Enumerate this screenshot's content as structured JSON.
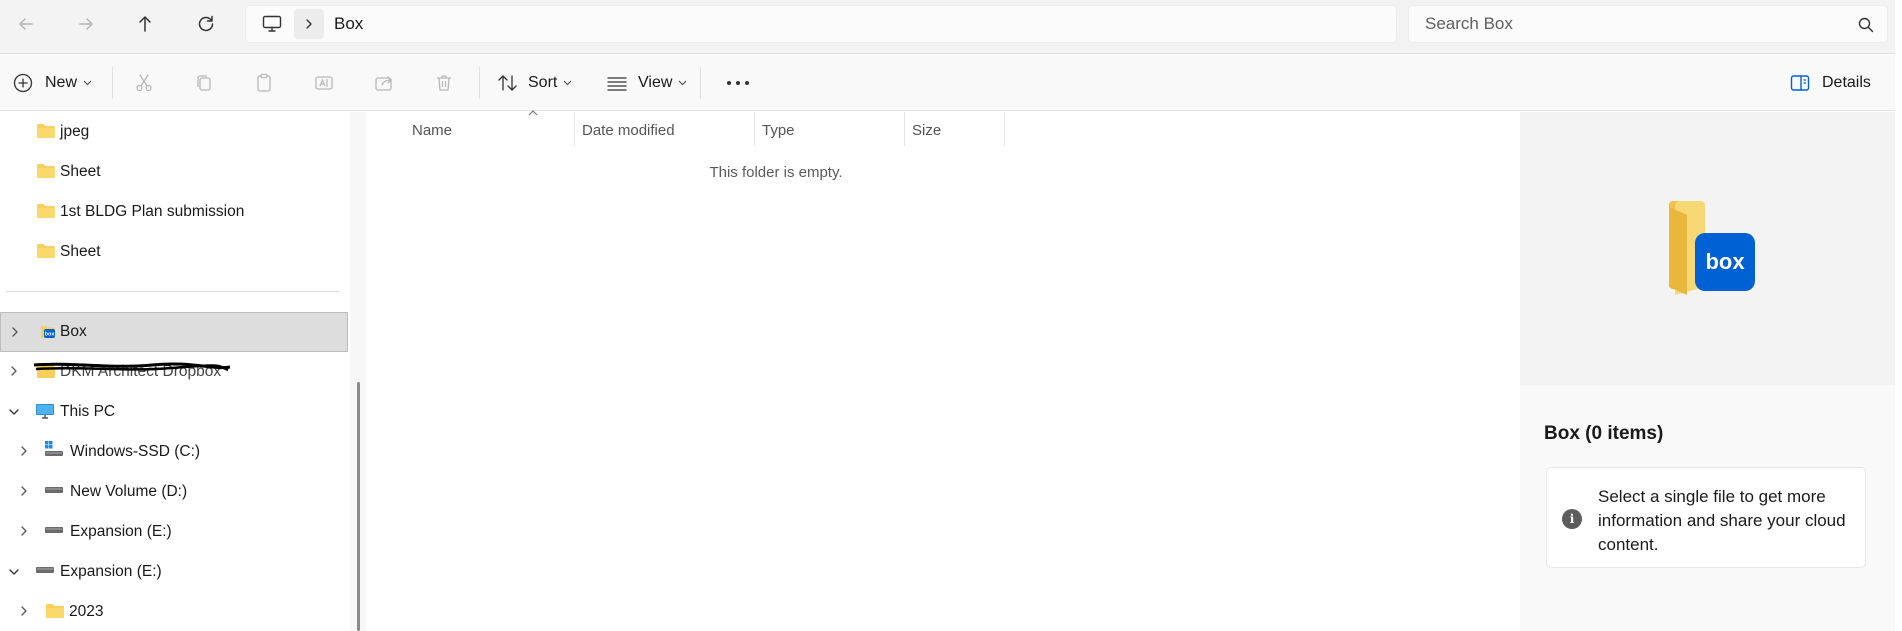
{
  "navigation": {
    "back_icon": "arrow-left-icon",
    "forward_icon": "arrow-right-icon",
    "up_icon": "arrow-up-icon",
    "refresh_icon": "refresh-icon"
  },
  "address_bar": {
    "location_icon": "this-pc-icon",
    "crumbs": [
      "Box"
    ]
  },
  "search": {
    "placeholder": "Search Box"
  },
  "toolbar": {
    "new_label": "New",
    "sort_label": "Sort",
    "view_label": "View",
    "details_label": "Details",
    "disabled_actions": [
      "cut",
      "copy",
      "paste",
      "rename",
      "share",
      "delete"
    ]
  },
  "sidebar": {
    "items": [
      {
        "label": "jpeg",
        "icon": "folder-icon"
      },
      {
        "label": "Sheet",
        "icon": "folder-icon"
      },
      {
        "label": "1st BLDG Plan submission",
        "icon": "folder-icon"
      },
      {
        "label": "Sheet",
        "icon": "folder-icon"
      },
      {
        "label": "Box",
        "icon": "box-folder-icon",
        "selected": true
      },
      {
        "label": "DKM Architect Dropbox",
        "icon": "dropbox-folder-icon",
        "redacted": true
      },
      {
        "label": "This PC",
        "icon": "this-pc-icon",
        "expanded": true
      },
      {
        "label": "Windows-SSD (C:)",
        "icon": "drive-windows-icon"
      },
      {
        "label": "New Volume (D:)",
        "icon": "drive-icon"
      },
      {
        "label": "Expansion (E:)",
        "icon": "drive-icon"
      },
      {
        "label": "Expansion (E:)",
        "icon": "drive-icon",
        "expanded": true
      },
      {
        "label": "2023",
        "icon": "folder-icon"
      }
    ]
  },
  "file_list": {
    "columns": [
      "Name",
      "Date modified",
      "Type",
      "Size"
    ],
    "empty_message": "This folder is empty."
  },
  "details": {
    "title": "Box (0 items)",
    "info_text": "Select a single file to get more information and share your cloud content.",
    "preview_icon": "box-folder-icon",
    "brand_color": "#0061d5"
  },
  "colors": {
    "folder_yellow": "#f8cf5a",
    "selection_bg": "#dddddd",
    "accent": "#0061d5"
  }
}
